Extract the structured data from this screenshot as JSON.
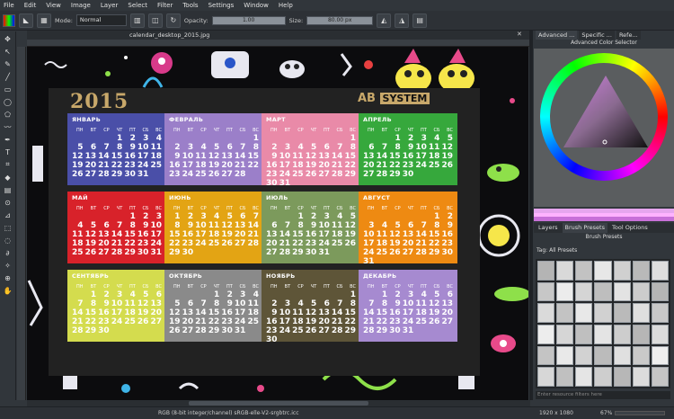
{
  "menu": [
    "File",
    "Edit",
    "View",
    "Image",
    "Layer",
    "Select",
    "Filter",
    "Tools",
    "Settings",
    "Window",
    "Help"
  ],
  "toolbar": {
    "mode_label": "Mode:",
    "mode_value": "Normal",
    "opacity_label": "Opacity:",
    "opacity_value": "1.00",
    "size_label": "Size:",
    "size_value": "80.00 px"
  },
  "document_tab": "calendar_desktop_2015.jpg",
  "calendar": {
    "year": "2015",
    "brand_left": "AB",
    "brand_right": "SYSTEM",
    "dow": [
      "ПН",
      "ВТ",
      "СР",
      "ЧТ",
      "ПТ",
      "СБ",
      "ВС"
    ],
    "months": [
      {
        "name": "ЯНВАРЬ",
        "color": "#4a4fa8",
        "start": 3,
        "days": 31
      },
      {
        "name": "ФЕВРАЛЬ",
        "color": "#9b7fc9",
        "start": 6,
        "days": 28
      },
      {
        "name": "МАРТ",
        "color": "#e98aa8",
        "start": 6,
        "days": 31
      },
      {
        "name": "АПРЕЛЬ",
        "color": "#36a83c",
        "start": 2,
        "days": 30
      },
      {
        "name": "МАЙ",
        "color": "#d8222a",
        "start": 4,
        "days": 31
      },
      {
        "name": "ИЮНЬ",
        "color": "#e3a414",
        "start": 0,
        "days": 30
      },
      {
        "name": "ИЮЛЬ",
        "color": "#7c9a5c",
        "start": 2,
        "days": 31
      },
      {
        "name": "АВГУСТ",
        "color": "#ee8a12",
        "start": 5,
        "days": 31
      },
      {
        "name": "СЕНТЯБРЬ",
        "color": "#d4dc4e",
        "start": 1,
        "days": 30
      },
      {
        "name": "ОКТЯБРЬ",
        "color": "#8a8a8a",
        "start": 3,
        "days": 31
      },
      {
        "name": "НОЯБРЬ",
        "color": "#5e5538",
        "start": 6,
        "days": 30
      },
      {
        "name": "ДЕКАБРЬ",
        "color": "#a68ad0",
        "start": 1,
        "days": 31
      }
    ]
  },
  "right_panel": {
    "tabs": [
      "Advanced ...",
      "Specific ...",
      "Refe..."
    ],
    "color_selector_title": "Advanced Color Selector",
    "lower_tabs": [
      "Layers",
      "Brush Presets",
      "Tool Options"
    ],
    "brush_presets_title": "Brush Presets",
    "tag_label": "Tag: All Presets",
    "filter_placeholder": "Enter resource filters here"
  },
  "status": {
    "color_model": "RGB (8-bit integer/channel)  sRGB-elle-V2-srgbtrc.icc",
    "dimensions": "1920 x 1080",
    "zoom": "67%"
  }
}
